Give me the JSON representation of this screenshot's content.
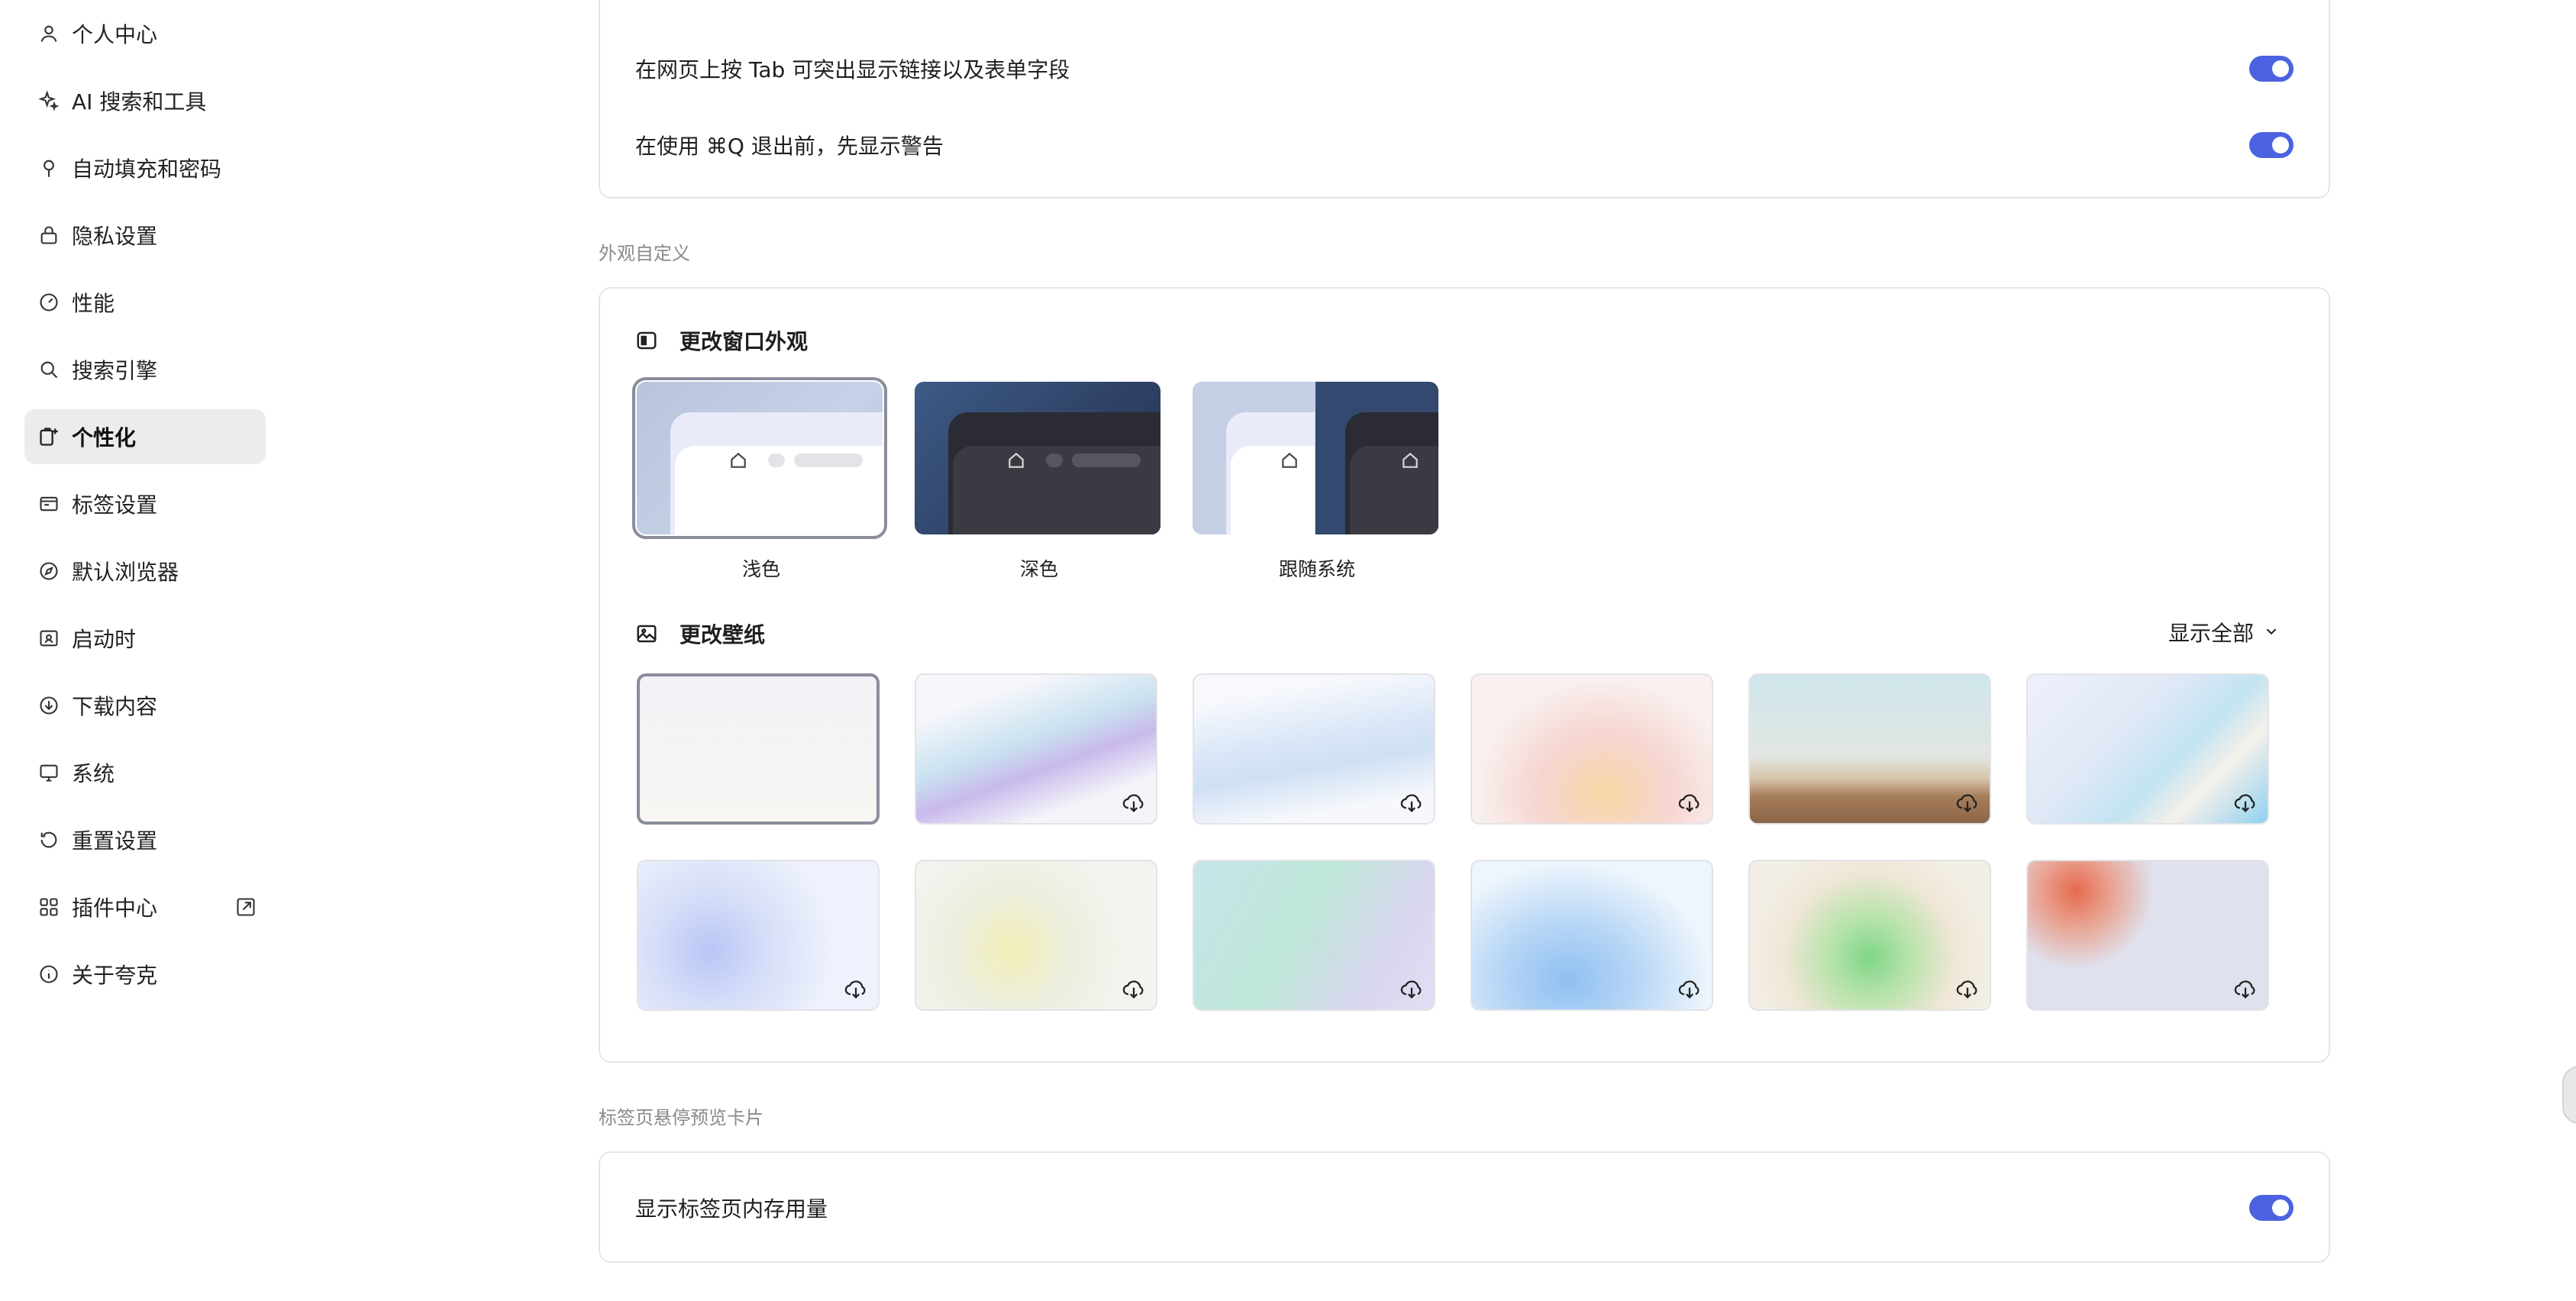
{
  "sidebar": {
    "items": [
      {
        "label": "个人中心",
        "icon": "user-icon"
      },
      {
        "label": "AI 搜索和工具",
        "icon": "sparkle-icon"
      },
      {
        "label": "自动填充和密码",
        "icon": "pin-icon"
      },
      {
        "label": "隐私设置",
        "icon": "lock-icon"
      },
      {
        "label": "性能",
        "icon": "gauge-icon"
      },
      {
        "label": "搜索引擎",
        "icon": "search-icon"
      },
      {
        "label": "个性化",
        "icon": "personalize-icon",
        "active": true
      },
      {
        "label": "标签设置",
        "icon": "tab-icon"
      },
      {
        "label": "默认浏览器",
        "icon": "compass-icon"
      },
      {
        "label": "启动时",
        "icon": "startup-icon"
      },
      {
        "label": "下载内容",
        "icon": "download-icon"
      },
      {
        "label": "系统",
        "icon": "monitor-icon"
      },
      {
        "label": "重置设置",
        "icon": "reset-icon"
      },
      {
        "label": "插件中心",
        "icon": "grid-icon",
        "external_icon": "external-link-icon"
      },
      {
        "label": "关于夸克",
        "icon": "info-icon"
      }
    ]
  },
  "top_card": {
    "rows": [
      {
        "text": "在网页上按 Tab 可突出显示链接以及表单字段",
        "toggle": true
      },
      {
        "text": "在使用 ⌘Q 退出前，先显示警告",
        "toggle": true
      }
    ]
  },
  "appearance": {
    "section_label": "外观自定义",
    "window_title": "更改窗口外观",
    "themes": [
      {
        "label": "浅色",
        "selected": true
      },
      {
        "label": "深色",
        "selected": false
      },
      {
        "label": "跟随系统",
        "selected": false
      }
    ],
    "wallpaper_title": "更改壁纸",
    "show_all": "显示全部"
  },
  "hover_card": {
    "section_label": "标签页悬停预览卡片",
    "rows": [
      {
        "text": "显示标签页内存用量",
        "toggle": true
      }
    ]
  },
  "colors": {
    "accent": "#4b63e0",
    "active_bg": "#ececee",
    "card_border": "#e6e6e9"
  }
}
